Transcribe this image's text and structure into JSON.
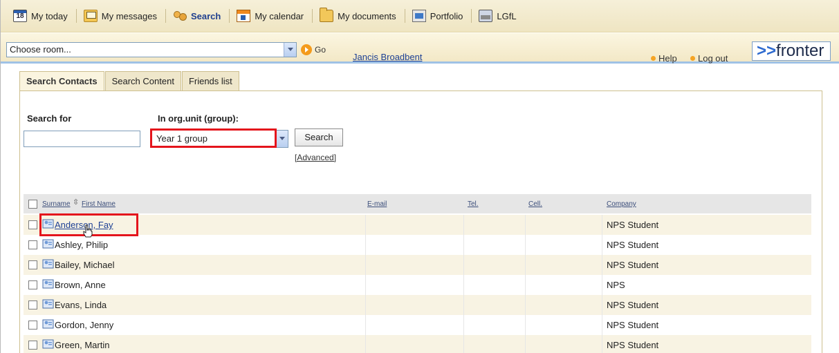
{
  "nav": {
    "items": [
      {
        "label": "My today",
        "icon": "calendar-day-icon"
      },
      {
        "label": "My messages",
        "icon": "messages-icon"
      },
      {
        "label": "Search",
        "icon": "search-people-icon"
      },
      {
        "label": "My calendar",
        "icon": "calendar-icon"
      },
      {
        "label": "My documents",
        "icon": "folder-icon"
      },
      {
        "label": "Portfolio",
        "icon": "portfolio-icon"
      },
      {
        "label": "LGfL",
        "icon": "lgfl-icon"
      }
    ],
    "today_icon_text": "18"
  },
  "bar": {
    "room_select": "Choose room...",
    "go_label": "Go",
    "user": "Jancis Broadbent",
    "help": "Help",
    "logout": "Log out",
    "logo_arrows": ">>",
    "logo_text": "fronter"
  },
  "tabs": [
    "Search Contacts",
    "Search Content",
    "Friends list"
  ],
  "form": {
    "search_for_label": "Search for",
    "search_for_value": "",
    "org_label": "In org.unit (group):",
    "org_value": "Year 1 group",
    "search_button": "Search",
    "advanced_link": "[Advanced]"
  },
  "table": {
    "headers": {
      "surname": "Surname",
      "first_name": "First Name",
      "email": "E-mail",
      "tel": "Tel.",
      "cell": "Cell.",
      "company": "Company"
    },
    "rows": [
      {
        "name": "Anderson, Fay",
        "company": "NPS Student"
      },
      {
        "name": "Ashley, Philip",
        "company": "NPS Student"
      },
      {
        "name": "Bailey, Michael",
        "company": "NPS Student"
      },
      {
        "name": "Brown, Anne",
        "company": "NPS"
      },
      {
        "name": "Evans, Linda",
        "company": "NPS Student"
      },
      {
        "name": "Gordon, Jenny",
        "company": "NPS Student"
      },
      {
        "name": "Green, Martin",
        "company": "NPS Student"
      }
    ]
  },
  "colors": {
    "highlight": "#e4141c",
    "link": "#1c3f94",
    "accent_orange": "#f5a425"
  }
}
